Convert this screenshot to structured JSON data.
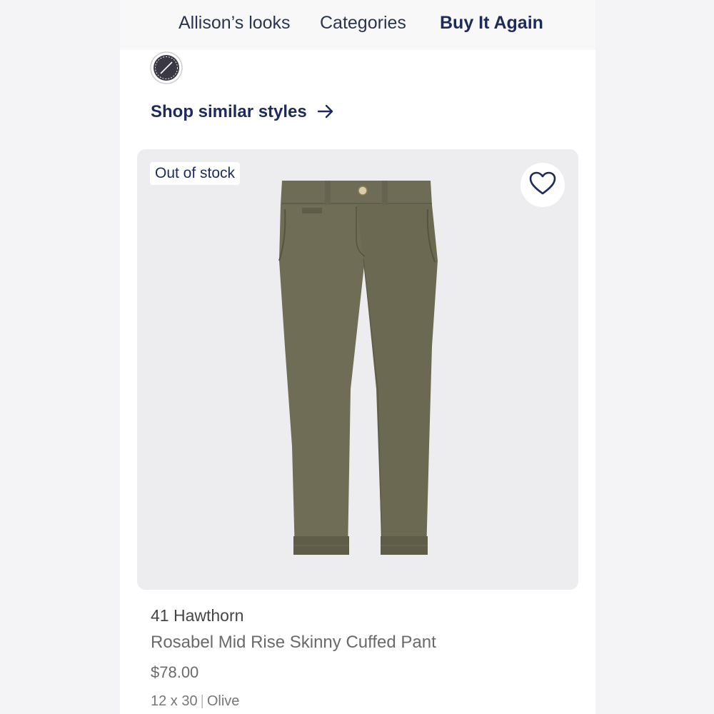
{
  "nav": {
    "tabs": [
      {
        "label": "Allison’s looks"
      },
      {
        "label": "Categories"
      },
      {
        "label": "Buy It Again"
      }
    ]
  },
  "swatch": {
    "color": "#3b3845",
    "icon": "color-swatch-icon"
  },
  "shop_similar": {
    "label": "Shop similar styles",
    "icon": "arrow-right-icon"
  },
  "product": {
    "badge": "Out of stock",
    "favorite_icon": "heart-outline-icon",
    "image_icon": "olive-pants-image",
    "brand": "41 Hawthorn",
    "name": "Rosabel Mid Rise Skinny Cuffed Pant",
    "price": "$78.00",
    "size": "12 x 30",
    "separator": "|",
    "color": "Olive"
  },
  "colors": {
    "accent": "#1d2b5a",
    "product_olive": "#6e6c55",
    "card_background": "#ededf0"
  }
}
